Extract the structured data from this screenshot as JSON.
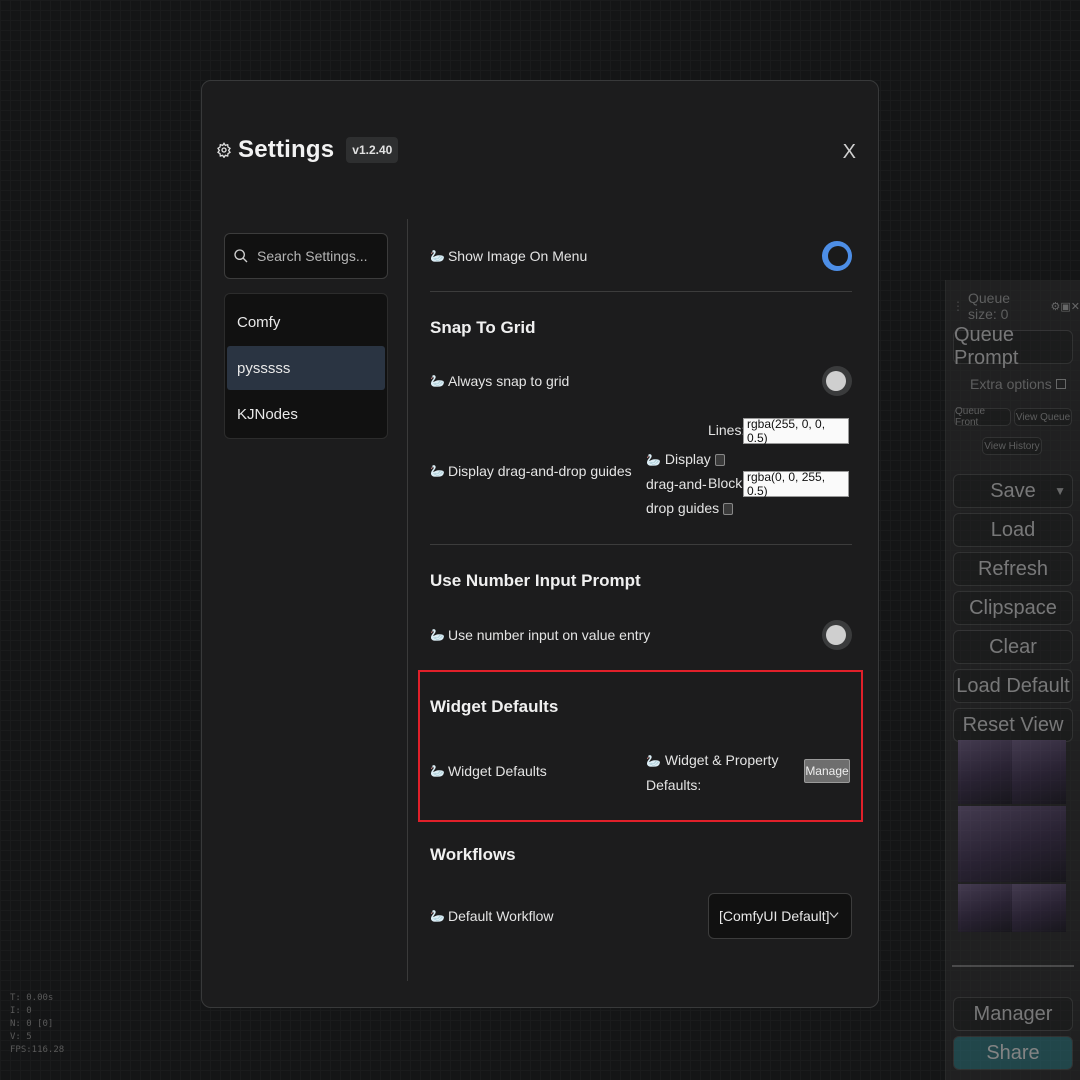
{
  "stats": [
    "T: 0.00s",
    "I: 0",
    "N: 0 [0]",
    "V: 5",
    "FPS:116.28"
  ],
  "side_menu": {
    "queue_size": "Queue size: 0",
    "queue_prompt": "Queue Prompt",
    "extra_options": "Extra options",
    "queue_front": "Queue Front",
    "view_queue": "View Queue",
    "view_history": "View History",
    "save": "Save",
    "load": "Load",
    "refresh": "Refresh",
    "clipspace": "Clipspace",
    "clear": "Clear",
    "load_default": "Load Default",
    "reset_view": "Reset View",
    "manager": "Manager",
    "share": "Share"
  },
  "dialog": {
    "title": "Settings",
    "version": "v1.2.40",
    "close": "X",
    "search_placeholder": "Search Settings...",
    "categories": [
      {
        "label": "Comfy",
        "active": false
      },
      {
        "label": "pysssss",
        "active": true
      },
      {
        "label": "KJNodes",
        "active": false
      }
    ]
  },
  "settings": {
    "show_image_on_menu": {
      "label": "Show Image On Menu",
      "value": true
    },
    "snap_section": "Snap To Grid",
    "always_snap": {
      "label": "Always snap to grid",
      "value": false
    },
    "dnd_guides": {
      "label": "Display drag-and-drop guides",
      "inner_label_1": "Display",
      "inner_label_2": "drag-and-",
      "inner_label_3": "drop guides",
      "lines_label": "Lines:",
      "lines_value": "rgba(255, 0, 0, 0.5)",
      "block_label": "Block:",
      "block_value": "rgba(0, 0, 255, 0.5)"
    },
    "number_input_section": "Use Number Input Prompt",
    "number_input": {
      "label": "Use number input on value entry",
      "value": false
    },
    "widget_defaults_section": "Widget Defaults",
    "widget_defaults": {
      "label": "Widget Defaults",
      "inner_label_1": "Widget & Property",
      "inner_label_2": "Defaults:",
      "manage": "Manage"
    },
    "workflows_section": "Workflows",
    "default_workflow": {
      "label": "Default Workflow",
      "value": "[ComfyUI Default]"
    }
  },
  "colors": {
    "toggle_on": "#4d8ee6",
    "highlight": "#e0202a",
    "share": "#2c6e76"
  }
}
